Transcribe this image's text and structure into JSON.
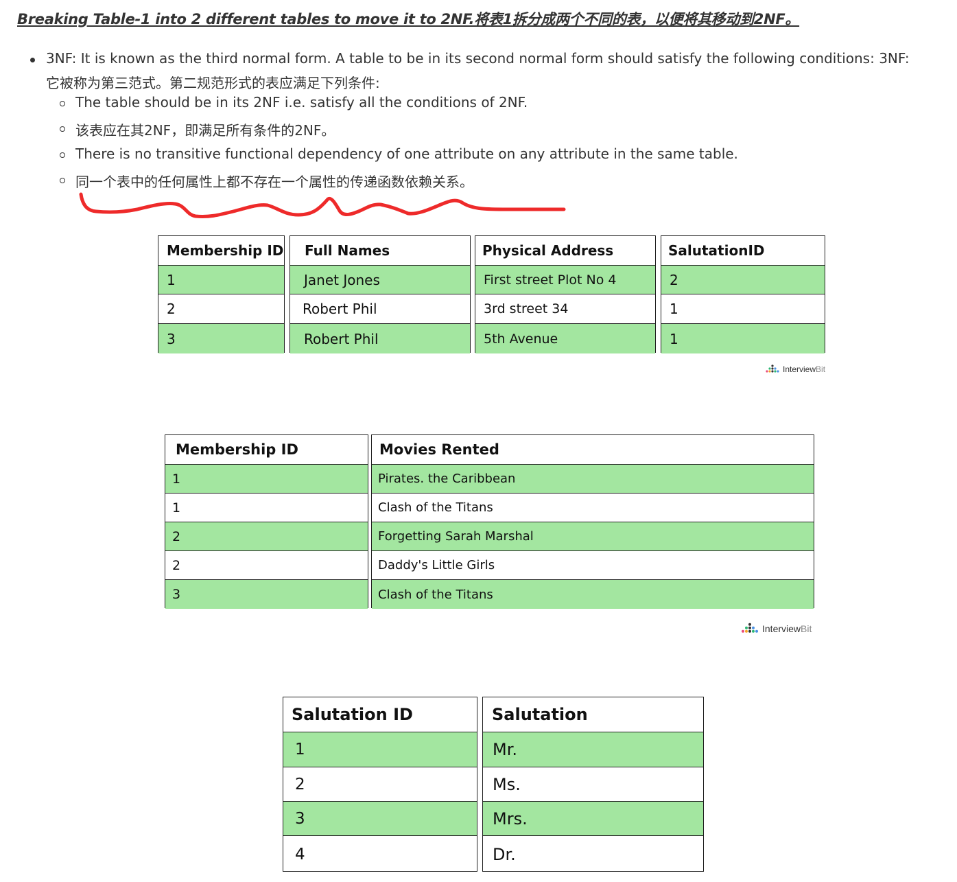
{
  "heading": "Breaking Table-1 into 2 different tables to move it to 2NF.将表1拆分成两个不同的表，以便将其移动到2NF。",
  "intro": {
    "line1": "3NF: It is known as the third normal form. A table to be in its second normal form should satisfy the following conditions:   3NF:",
    "line2": "它被称为第三范式。第二规范形式的表应满足下列条件:"
  },
  "conditions": [
    "The table should be in its 2NF i.e. satisfy all the conditions of 2NF.",
    "该表应在其2NF，即满足所有条件的2NF。",
    "There is no transitive functional dependency of one attribute on any attribute in the same table.",
    "同一个表中的任何属性上都不存在一个属性的传递函数依赖关系。"
  ],
  "colors": {
    "green_row": "#a3e6a0",
    "scribble": "#ee2a2a"
  },
  "watermark": {
    "brand_a": "Interview",
    "brand_b": "Bit",
    "icon": "interviewbit-logo-icon"
  },
  "table1": {
    "headers": [
      "Membership ID",
      "Full Names",
      "Physical Address",
      "SalutationID"
    ],
    "rows": [
      [
        "1",
        "Janet Jones",
        "First street Plot No 4",
        "2"
      ],
      [
        "2",
        "Robert Phil",
        "3rd street 34",
        "1"
      ],
      [
        "3",
        "Robert Phil",
        "5th Avenue",
        "1"
      ]
    ]
  },
  "table2": {
    "headers": [
      "Membership ID",
      "Movies Rented"
    ],
    "rows": [
      [
        "1",
        "Pirates. the Caribbean"
      ],
      [
        "1",
        "Clash of the Titans"
      ],
      [
        "2",
        "Forgetting Sarah Marshal"
      ],
      [
        "2",
        "Daddy's Little Girls"
      ],
      [
        "3",
        "Clash of the Titans"
      ]
    ]
  },
  "table3": {
    "headers": [
      "Salutation ID",
      "Salutation"
    ],
    "rows": [
      [
        "1",
        "Mr."
      ],
      [
        "2",
        "Ms."
      ],
      [
        "3",
        "Mrs."
      ],
      [
        "4",
        "Dr."
      ]
    ]
  }
}
